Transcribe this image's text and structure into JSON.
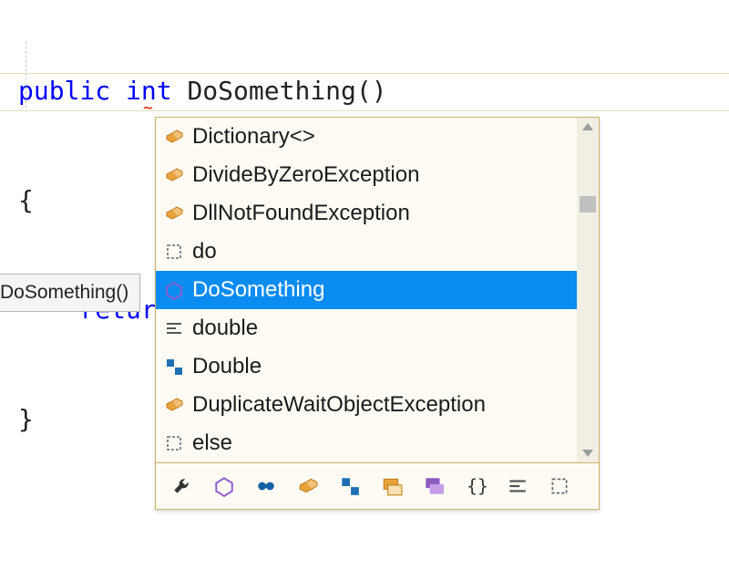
{
  "code": {
    "line1": {
      "kw1": "public",
      "kw2": "int",
      "name": "DoSomething()"
    },
    "line2": "{",
    "line3": {
      "indent": "    ",
      "kw": "return"
    },
    "line4": "}"
  },
  "squiggle": "~",
  "hint": {
    "signature": "DoSomething()"
  },
  "completion": {
    "items": [
      {
        "label": "Dictionary<>",
        "icon": "class-icon",
        "selected": false
      },
      {
        "label": "DivideByZeroException",
        "icon": "class-icon",
        "selected": false
      },
      {
        "label": "DllNotFoundException",
        "icon": "class-icon",
        "selected": false
      },
      {
        "label": "do",
        "icon": "keyword-icon",
        "selected": false
      },
      {
        "label": "DoSomething",
        "icon": "method-icon",
        "selected": true
      },
      {
        "label": "double",
        "icon": "snippet-icon",
        "selected": false
      },
      {
        "label": "Double",
        "icon": "struct-icon",
        "selected": false
      },
      {
        "label": "DuplicateWaitObjectException",
        "icon": "class-icon",
        "selected": false
      },
      {
        "label": "else",
        "icon": "keyword-icon",
        "selected": false
      }
    ],
    "filters": [
      "wrench-icon",
      "method-icon",
      "field-icon",
      "class-icon",
      "struct-icon",
      "enum-icon",
      "interface-icon",
      "brace-icon",
      "snippet-icon",
      "keyword-icon"
    ]
  },
  "colors": {
    "selection": "#0b8cf0",
    "popup_border": "#ccb46a",
    "kw": "#0000ff"
  }
}
